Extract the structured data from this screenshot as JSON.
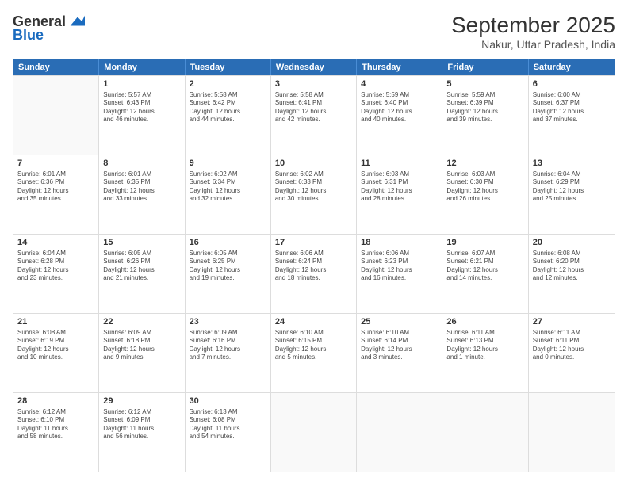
{
  "logo": {
    "line1": "General",
    "line2": "Blue"
  },
  "header": {
    "month": "September 2025",
    "location": "Nakur, Uttar Pradesh, India"
  },
  "weekdays": [
    "Sunday",
    "Monday",
    "Tuesday",
    "Wednesday",
    "Thursday",
    "Friday",
    "Saturday"
  ],
  "weeks": [
    [
      {
        "day": "",
        "text": ""
      },
      {
        "day": "1",
        "text": "Sunrise: 5:57 AM\nSunset: 6:43 PM\nDaylight: 12 hours\nand 46 minutes."
      },
      {
        "day": "2",
        "text": "Sunrise: 5:58 AM\nSunset: 6:42 PM\nDaylight: 12 hours\nand 44 minutes."
      },
      {
        "day": "3",
        "text": "Sunrise: 5:58 AM\nSunset: 6:41 PM\nDaylight: 12 hours\nand 42 minutes."
      },
      {
        "day": "4",
        "text": "Sunrise: 5:59 AM\nSunset: 6:40 PM\nDaylight: 12 hours\nand 40 minutes."
      },
      {
        "day": "5",
        "text": "Sunrise: 5:59 AM\nSunset: 6:39 PM\nDaylight: 12 hours\nand 39 minutes."
      },
      {
        "day": "6",
        "text": "Sunrise: 6:00 AM\nSunset: 6:37 PM\nDaylight: 12 hours\nand 37 minutes."
      }
    ],
    [
      {
        "day": "7",
        "text": "Sunrise: 6:01 AM\nSunset: 6:36 PM\nDaylight: 12 hours\nand 35 minutes."
      },
      {
        "day": "8",
        "text": "Sunrise: 6:01 AM\nSunset: 6:35 PM\nDaylight: 12 hours\nand 33 minutes."
      },
      {
        "day": "9",
        "text": "Sunrise: 6:02 AM\nSunset: 6:34 PM\nDaylight: 12 hours\nand 32 minutes."
      },
      {
        "day": "10",
        "text": "Sunrise: 6:02 AM\nSunset: 6:33 PM\nDaylight: 12 hours\nand 30 minutes."
      },
      {
        "day": "11",
        "text": "Sunrise: 6:03 AM\nSunset: 6:31 PM\nDaylight: 12 hours\nand 28 minutes."
      },
      {
        "day": "12",
        "text": "Sunrise: 6:03 AM\nSunset: 6:30 PM\nDaylight: 12 hours\nand 26 minutes."
      },
      {
        "day": "13",
        "text": "Sunrise: 6:04 AM\nSunset: 6:29 PM\nDaylight: 12 hours\nand 25 minutes."
      }
    ],
    [
      {
        "day": "14",
        "text": "Sunrise: 6:04 AM\nSunset: 6:28 PM\nDaylight: 12 hours\nand 23 minutes."
      },
      {
        "day": "15",
        "text": "Sunrise: 6:05 AM\nSunset: 6:26 PM\nDaylight: 12 hours\nand 21 minutes."
      },
      {
        "day": "16",
        "text": "Sunrise: 6:05 AM\nSunset: 6:25 PM\nDaylight: 12 hours\nand 19 minutes."
      },
      {
        "day": "17",
        "text": "Sunrise: 6:06 AM\nSunset: 6:24 PM\nDaylight: 12 hours\nand 18 minutes."
      },
      {
        "day": "18",
        "text": "Sunrise: 6:06 AM\nSunset: 6:23 PM\nDaylight: 12 hours\nand 16 minutes."
      },
      {
        "day": "19",
        "text": "Sunrise: 6:07 AM\nSunset: 6:21 PM\nDaylight: 12 hours\nand 14 minutes."
      },
      {
        "day": "20",
        "text": "Sunrise: 6:08 AM\nSunset: 6:20 PM\nDaylight: 12 hours\nand 12 minutes."
      }
    ],
    [
      {
        "day": "21",
        "text": "Sunrise: 6:08 AM\nSunset: 6:19 PM\nDaylight: 12 hours\nand 10 minutes."
      },
      {
        "day": "22",
        "text": "Sunrise: 6:09 AM\nSunset: 6:18 PM\nDaylight: 12 hours\nand 9 minutes."
      },
      {
        "day": "23",
        "text": "Sunrise: 6:09 AM\nSunset: 6:16 PM\nDaylight: 12 hours\nand 7 minutes."
      },
      {
        "day": "24",
        "text": "Sunrise: 6:10 AM\nSunset: 6:15 PM\nDaylight: 12 hours\nand 5 minutes."
      },
      {
        "day": "25",
        "text": "Sunrise: 6:10 AM\nSunset: 6:14 PM\nDaylight: 12 hours\nand 3 minutes."
      },
      {
        "day": "26",
        "text": "Sunrise: 6:11 AM\nSunset: 6:13 PM\nDaylight: 12 hours\nand 1 minute."
      },
      {
        "day": "27",
        "text": "Sunrise: 6:11 AM\nSunset: 6:11 PM\nDaylight: 12 hours\nand 0 minutes."
      }
    ],
    [
      {
        "day": "28",
        "text": "Sunrise: 6:12 AM\nSunset: 6:10 PM\nDaylight: 11 hours\nand 58 minutes."
      },
      {
        "day": "29",
        "text": "Sunrise: 6:12 AM\nSunset: 6:09 PM\nDaylight: 11 hours\nand 56 minutes."
      },
      {
        "day": "30",
        "text": "Sunrise: 6:13 AM\nSunset: 6:08 PM\nDaylight: 11 hours\nand 54 minutes."
      },
      {
        "day": "",
        "text": ""
      },
      {
        "day": "",
        "text": ""
      },
      {
        "day": "",
        "text": ""
      },
      {
        "day": "",
        "text": ""
      }
    ]
  ]
}
